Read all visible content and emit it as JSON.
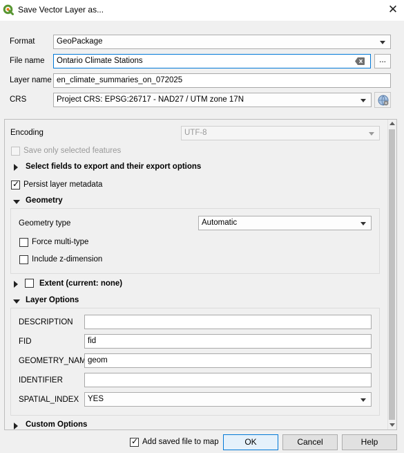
{
  "window": {
    "title": "Save Vector Layer as..."
  },
  "form": {
    "format_label": "Format",
    "format_value": "GeoPackage",
    "file_name_label": "File name",
    "file_name_value": "Ontario Climate Stations",
    "browse_label": "...",
    "layer_name_label": "Layer name",
    "layer_name_value": "en_climate_summaries_on_072025",
    "crs_label": "CRS",
    "crs_value": "Project CRS: EPSG:26717 - NAD27 / UTM zone 17N"
  },
  "options": {
    "encoding_label": "Encoding",
    "encoding_value": "UTF-8",
    "save_selected_label": "Save only selected features",
    "select_fields_label": "Select fields to export and their export options",
    "persist_metadata_label": "Persist layer metadata"
  },
  "geometry": {
    "section_label": "Geometry",
    "type_label": "Geometry type",
    "type_value": "Automatic",
    "force_multi_label": "Force multi-type",
    "include_z_label": "Include z-dimension"
  },
  "extent": {
    "label": "Extent (current: none)"
  },
  "layer_options": {
    "section_label": "Layer Options",
    "rows": [
      {
        "label": "DESCRIPTION",
        "value": ""
      },
      {
        "label": "FID",
        "value": "fid"
      },
      {
        "label": "GEOMETRY_NAME",
        "value": "geom"
      },
      {
        "label": "IDENTIFIER",
        "value": ""
      },
      {
        "label": "SPATIAL_INDEX",
        "value": "YES"
      }
    ]
  },
  "custom_options": {
    "label": "Custom Options"
  },
  "footer": {
    "add_saved_label": "Add saved file to map",
    "ok_label": "OK",
    "cancel_label": "Cancel",
    "help_label": "Help"
  },
  "colors": {
    "qgis_green": "#589632",
    "default_button_border": "#0078d7"
  }
}
